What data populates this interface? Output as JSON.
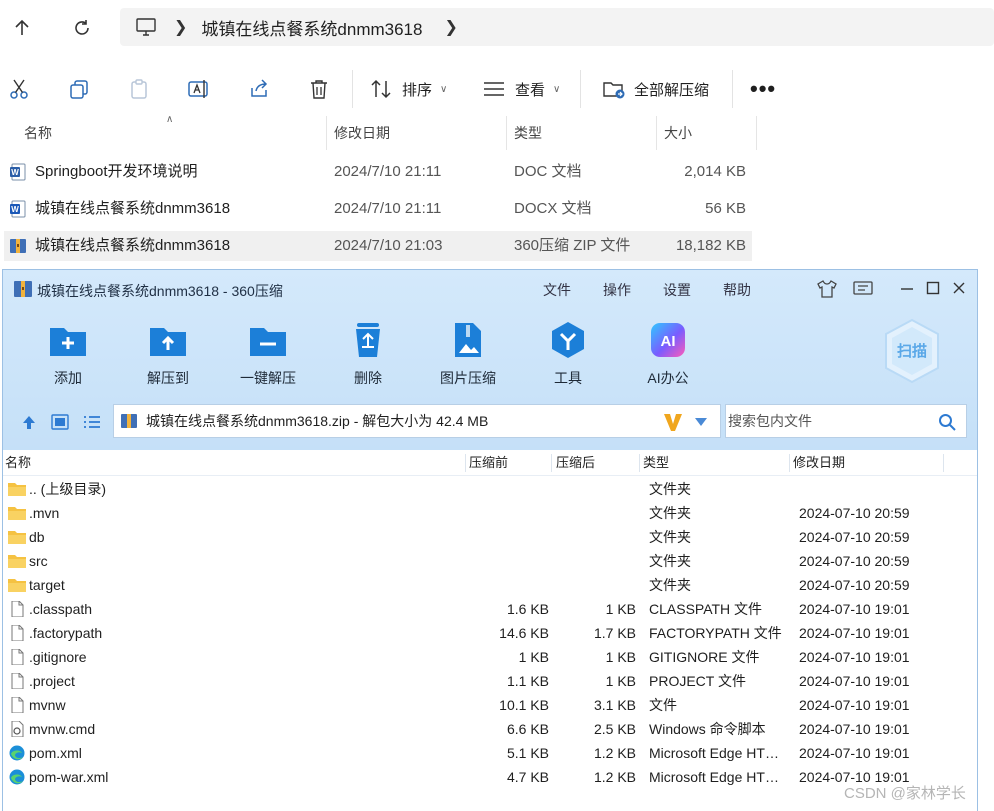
{
  "explorer": {
    "breadcrumb": "城镇在线点餐系统dnmm3618",
    "toolbar": {
      "sort_label": "排序",
      "view_label": "查看",
      "extract_all_label": "全部解压缩",
      "more_label": "•••"
    },
    "columns": {
      "name": "名称",
      "modified": "修改日期",
      "type": "类型",
      "size": "大小"
    },
    "files": [
      {
        "name": "Springboot开发环境说明",
        "modified": "2024/7/10 21:11",
        "type": "DOC 文档",
        "size": "2,014 KB",
        "icon": "word-doc-icon"
      },
      {
        "name": "城镇在线点餐系统dnmm3618",
        "modified": "2024/7/10 21:11",
        "type": "DOCX 文档",
        "size": "56 KB",
        "icon": "word-docx-icon"
      },
      {
        "name": "城镇在线点餐系统dnmm3618",
        "modified": "2024/7/10 21:03",
        "type": "360压缩 ZIP 文件",
        "size": "18,182 KB",
        "icon": "zip-archive-icon",
        "selected": true
      }
    ]
  },
  "zip_window": {
    "title": "城镇在线点餐系统dnmm3618 - 360压缩",
    "menu": {
      "file": "文件",
      "operate": "操作",
      "settings": "设置",
      "help": "帮助"
    },
    "tools": {
      "add": "添加",
      "extract_to": "解压到",
      "one_click_extract": "一键解压",
      "delete": "删除",
      "image_compress": "图片压缩",
      "tools": "工具",
      "ai_office": "AI办公"
    },
    "scan_label": "扫描",
    "ai_badge": "AI",
    "path_text": "城镇在线点餐系统dnmm3618.zip - 解包大小为 42.4 MB",
    "search_placeholder": "搜索包内文件",
    "columns": {
      "name": "名称",
      "before": "压缩前",
      "after": "压缩后",
      "type": "类型",
      "modified": "修改日期"
    },
    "entries": [
      {
        "name": ".. (上级目录)",
        "before": "",
        "after": "",
        "type": "文件夹",
        "modified": "",
        "icon": "folder-icon"
      },
      {
        "name": ".mvn",
        "before": "",
        "after": "",
        "type": "文件夹",
        "modified": "2024-07-10 20:59",
        "icon": "folder-icon"
      },
      {
        "name": "db",
        "before": "",
        "after": "",
        "type": "文件夹",
        "modified": "2024-07-10 20:59",
        "icon": "folder-icon"
      },
      {
        "name": "src",
        "before": "",
        "after": "",
        "type": "文件夹",
        "modified": "2024-07-10 20:59",
        "icon": "folder-icon"
      },
      {
        "name": "target",
        "before": "",
        "after": "",
        "type": "文件夹",
        "modified": "2024-07-10 20:59",
        "icon": "folder-icon"
      },
      {
        "name": ".classpath",
        "before": "1.6 KB",
        "after": "1 KB",
        "type": "CLASSPATH 文件",
        "modified": "2024-07-10 19:01",
        "icon": "file-icon"
      },
      {
        "name": ".factorypath",
        "before": "14.6 KB",
        "after": "1.7 KB",
        "type": "FACTORYPATH 文件",
        "modified": "2024-07-10 19:01",
        "icon": "file-icon"
      },
      {
        "name": ".gitignore",
        "before": "1 KB",
        "after": "1 KB",
        "type": "GITIGNORE 文件",
        "modified": "2024-07-10 19:01",
        "icon": "file-icon"
      },
      {
        "name": ".project",
        "before": "1.1 KB",
        "after": "1 KB",
        "type": "PROJECT 文件",
        "modified": "2024-07-10 19:01",
        "icon": "file-icon"
      },
      {
        "name": "mvnw",
        "before": "10.1 KB",
        "after": "3.1 KB",
        "type": "文件",
        "modified": "2024-07-10 19:01",
        "icon": "file-icon"
      },
      {
        "name": "mvnw.cmd",
        "before": "6.6 KB",
        "after": "2.5 KB",
        "type": "Windows 命令脚本",
        "modified": "2024-07-10 19:01",
        "icon": "cmd-script-icon"
      },
      {
        "name": "pom.xml",
        "before": "5.1 KB",
        "after": "1.2 KB",
        "type": "Microsoft Edge HTML 文档",
        "modified": "2024-07-10 19:01",
        "icon": "edge-icon"
      },
      {
        "name": "pom-war.xml",
        "before": "4.7 KB",
        "after": "1.2 KB",
        "type": "Microsoft Edge HTML 文档",
        "modified": "2024-07-10 19:01",
        "icon": "edge-icon"
      }
    ]
  },
  "watermark": "CSDN @家林学长"
}
